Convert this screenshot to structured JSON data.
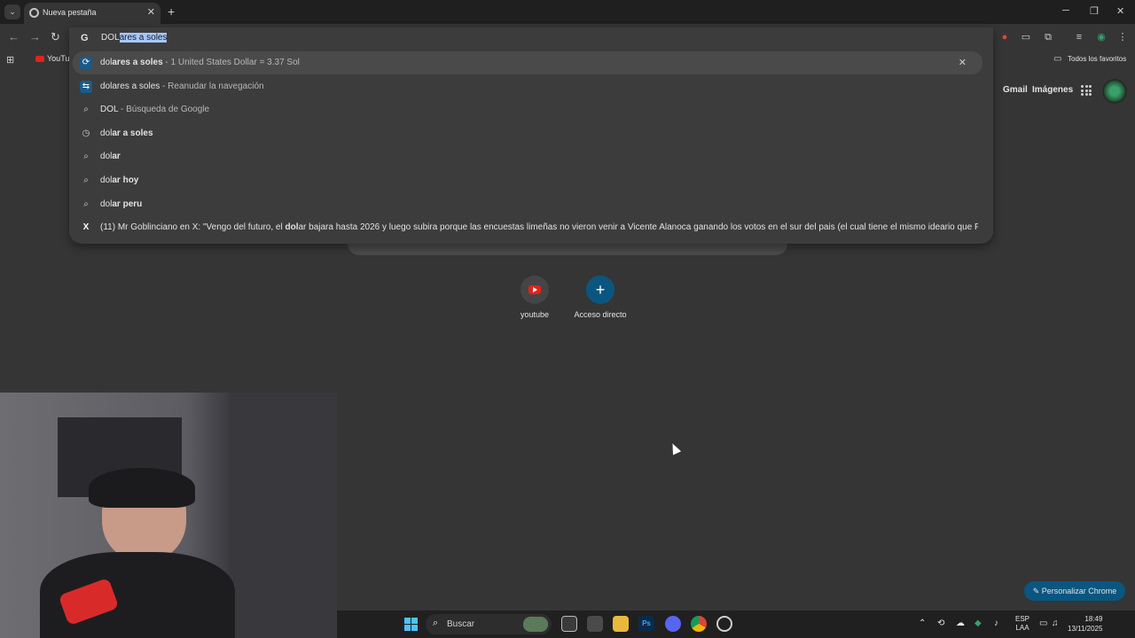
{
  "tab": {
    "title": "Nueva pestaña"
  },
  "window": {
    "minimize": "─",
    "restore": "❐",
    "close": "✕"
  },
  "omnibox": {
    "typed": "DOL",
    "autocomplete": "ares a soles"
  },
  "bookmarks": {
    "first": "YouTu",
    "all": "Todos los favoritos"
  },
  "suggestions": [
    {
      "bold_before": "dol",
      "bold": "ares a soles",
      "sep": " - ",
      "sub": "1 United States Dollar = 3.37 Sol",
      "icon": "currency-icon"
    },
    {
      "bold_before": "dol",
      "bold": "ares a soles",
      "sep": " - ",
      "sub": "Reanudar la navegación",
      "icon": "journeys-icon"
    },
    {
      "bold_before": "DOL",
      "bold": "",
      "sep": " - ",
      "sub": "Búsqueda de Google",
      "icon": "search-icon"
    },
    {
      "bold_before": "dol",
      "bold": "ar a soles",
      "sep": "",
      "sub": "",
      "icon": "history-icon"
    },
    {
      "bold_before": "dol",
      "bold": "ar",
      "sep": "",
      "sub": "",
      "icon": "search-icon"
    },
    {
      "bold_before": "dol",
      "bold": "ar hoy",
      "sep": "",
      "sub": "",
      "icon": "search-icon"
    },
    {
      "bold_before": "dol",
      "bold": "ar peru",
      "sep": "",
      "sub": "",
      "icon": "search-icon"
    }
  ],
  "x_suggestion": {
    "pre": "(11) Mr Goblinciano en X: \"Vengo del futuro, el ",
    "bold": "dol",
    "post": "ar bajara hasta 2026 y luego subira porque las encuestas limeñas no vieron venir a Vicente Alanoca ganando los votos en el sur del pais (el cual tiene el mismo ideario que PeruLibre..."
  },
  "google_bar": {
    "gmail": "Gmail",
    "images": "Imágenes"
  },
  "shortcuts": [
    {
      "label": "youtube"
    },
    {
      "label": "Acceso directo",
      "glyph": "+"
    }
  ],
  "customize": {
    "label": "Personalizar Chrome",
    "icon": "✎"
  },
  "taskbar": {
    "search_placeholder": "Buscar",
    "lang_top": "ESP",
    "lang_bottom": "LAA",
    "time": "18:49",
    "date": "13/11/2025"
  },
  "colors": {
    "accent": "#0a5680",
    "selection": "#a8c7fa",
    "youtube": "#e62117"
  }
}
